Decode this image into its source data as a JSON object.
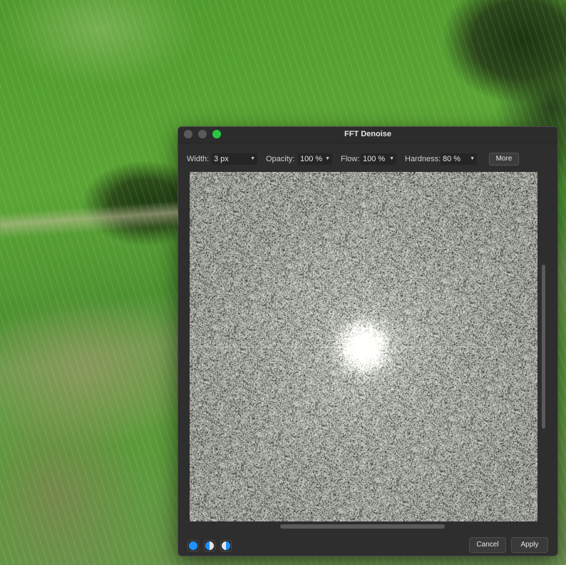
{
  "window": {
    "title": "FFT Denoise"
  },
  "toolbar": {
    "width": {
      "label": "Width:",
      "value": "3 px"
    },
    "opacity": {
      "label": "Opacity:",
      "value": "100 %"
    },
    "flow": {
      "label": "Flow:",
      "value": "100 %"
    },
    "hardness": {
      "label": "Hardness:",
      "value": "80 %"
    },
    "more_label": "More",
    "dropdown_icon": "chevron-down-icon"
  },
  "preview": {
    "description_icon": "fft-spectrum-canvas"
  },
  "footer": {
    "mode_icons": [
      "filled-circle-icon",
      "half-circle-icon",
      "half-circle-inverse-icon"
    ],
    "cancel_label": "Cancel",
    "apply_label": "Apply"
  },
  "colors": {
    "accent": "#1e90ff",
    "maximize": "#28c840",
    "dialog_bg": "#2e2e2e"
  }
}
